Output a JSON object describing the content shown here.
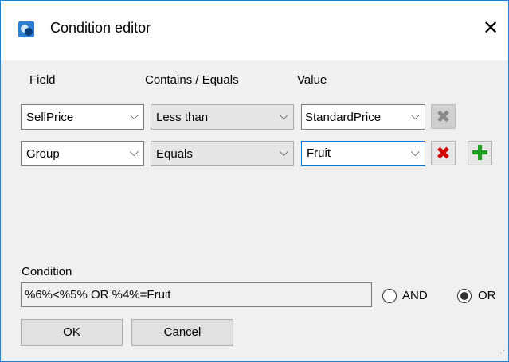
{
  "window": {
    "title": "Condition editor",
    "close_glyph": "✕"
  },
  "columns": {
    "field": "Field",
    "op": "Contains / Equals",
    "value": "Value"
  },
  "rows": [
    {
      "field": "SellPrice",
      "op": "Less than",
      "value": "StandardPrice"
    },
    {
      "field": "Group",
      "op": "Equals",
      "value": "Fruit"
    }
  ],
  "icons": {
    "dropdown": "⌵",
    "delete": "✖",
    "add": "✚"
  },
  "condition": {
    "label": "Condition",
    "value": "%6%<%5% OR %4%=Fruit"
  },
  "logic": {
    "and_label": "AND",
    "or_label": "OR",
    "selected": "OR"
  },
  "buttons": {
    "ok_key": "O",
    "ok_rest": "K",
    "cancel_key": "C",
    "cancel_rest": "ancel"
  },
  "colors": {
    "border": "#1883d7",
    "delete_active": "#d40000",
    "add": "#1e9e1e"
  }
}
